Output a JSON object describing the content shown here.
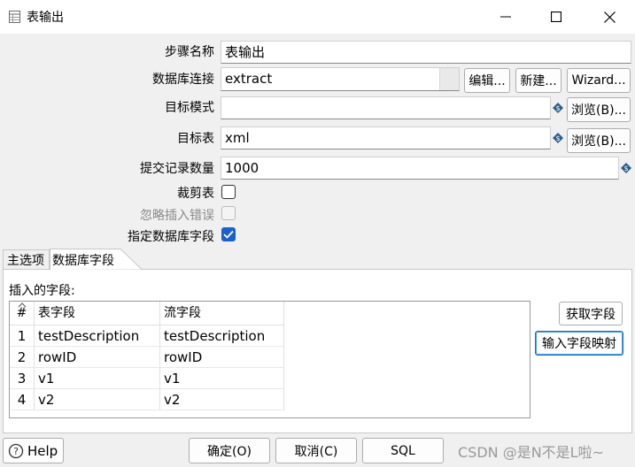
{
  "window": {
    "title": "表输出",
    "minimize_icon": "minimize-icon",
    "maximize_icon": "maximize-icon",
    "close_icon": "close-icon"
  },
  "form": {
    "step_name_label": "步骤名称",
    "step_name_value": "表输出",
    "db_conn_label": "数据库连接",
    "db_conn_value": "extract",
    "edit_button": "编辑...",
    "new_button": "新建...",
    "wizard_button": "Wizard...",
    "schema_label": "目标模式",
    "schema_value": "",
    "browse_button_schema": "浏览(B)...",
    "table_label": "目标表",
    "table_value": "xml",
    "browse_button_table": "浏览(B)...",
    "commit_label": "提交记录数量",
    "commit_value": "1000",
    "truncate_label": "裁剪表",
    "truncate_checked": false,
    "ignore_errors_label": "忽略插入错误",
    "ignore_errors_checked": false,
    "specify_fields_label": "指定数据库字段",
    "specify_fields_checked": true
  },
  "tabs": [
    {
      "label": "主选项",
      "active": false
    },
    {
      "label": "数据库字段",
      "active": true
    }
  ],
  "fields_panel": {
    "insert_label": "插入的字段:",
    "columns": [
      "#",
      "表字段",
      "流字段"
    ],
    "rows": [
      {
        "num": "1",
        "table_field": "testDescription",
        "stream_field": "testDescription"
      },
      {
        "num": "2",
        "table_field": "rowID",
        "stream_field": "rowID"
      },
      {
        "num": "3",
        "table_field": "v1",
        "stream_field": "v1"
      },
      {
        "num": "4",
        "table_field": "v2",
        "stream_field": "v2"
      }
    ],
    "get_fields_button": "获取字段",
    "map_fields_button": "输入字段映射"
  },
  "footer": {
    "help_button": "Help",
    "ok_button": "确定(O)",
    "cancel_button": "取消(C)",
    "sql_button": "SQL"
  },
  "watermark": "CSDN @是N不是L啦~",
  "colors": {
    "accent": "#1a62c8",
    "variable_icon": "#2c5d87"
  }
}
